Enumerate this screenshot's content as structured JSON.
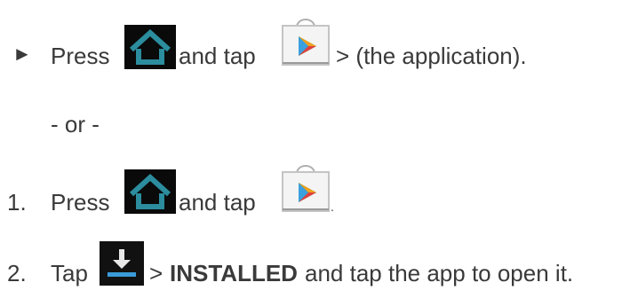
{
  "instructions": {
    "option_a": {
      "bullet": "►",
      "press": "Press",
      "and_tap": "and tap",
      "suffix": "> (the application).",
      "icons": [
        "home-icon",
        "play-store-icon"
      ]
    },
    "or_separator": "- or -",
    "steps": [
      {
        "number": "1.",
        "press": "Press",
        "and_tap": "and tap",
        "end": ".",
        "icons": [
          "home-icon",
          "play-store-icon"
        ]
      },
      {
        "number": "2.",
        "tap": "Tap",
        "gt": ">",
        "installed": "INSTALLED",
        "suffix": "and tap the app to open it.",
        "icons": [
          "download-icon"
        ]
      }
    ]
  },
  "colors": {
    "text": "#3a3a3a",
    "icon_dark": "#0a0a0a",
    "play_green": "#2db04b",
    "play_blue": "#3aa0e0",
    "play_orange": "#f0a020",
    "play_red": "#e04040"
  }
}
